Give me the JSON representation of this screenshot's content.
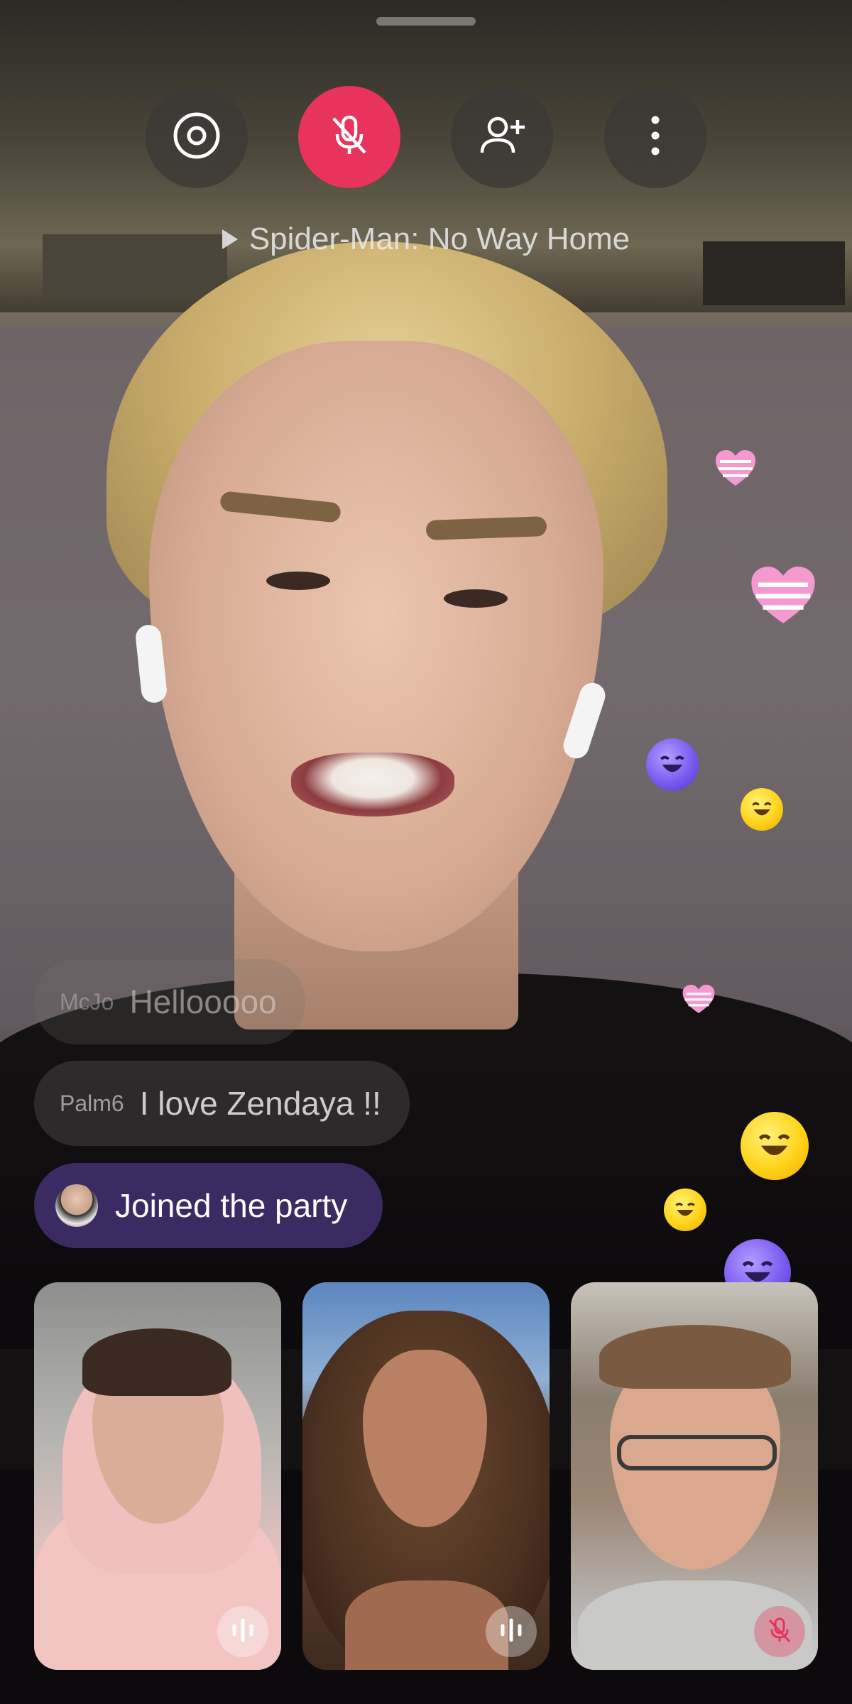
{
  "top_controls": {
    "buttons": [
      {
        "icon": "record-icon",
        "label": ""
      },
      {
        "icon": "mic-off-icon",
        "label": ""
      },
      {
        "icon": "add-person-icon",
        "label": ""
      },
      {
        "icon": "more-vertical-icon",
        "label": ""
      }
    ],
    "mic_color": "#e8345c"
  },
  "now_playing": {
    "icon": "play-icon",
    "title": "Spider-Man: No Way Home"
  },
  "chat": {
    "messages": [
      {
        "user": "McJo",
        "text": "Hellooooo"
      },
      {
        "user": "Palm6",
        "text": "I love Zendaya !!"
      }
    ],
    "join_notice": {
      "text": "Joined the party",
      "bg_color": "#3b2b62"
    }
  },
  "reactions": [
    "heart-icon",
    "heart-icon",
    "laughing-face-icon",
    "laughing-face-icon",
    "heart-icon",
    "laughing-face-icon",
    "laughing-face-icon",
    "laughing-face-icon"
  ],
  "participants": [
    {
      "status": "speaking",
      "status_icon": "audio-wave-icon"
    },
    {
      "status": "speaking",
      "status_icon": "audio-wave-icon"
    },
    {
      "status": "muted",
      "status_icon": "mic-off-icon"
    }
  ]
}
